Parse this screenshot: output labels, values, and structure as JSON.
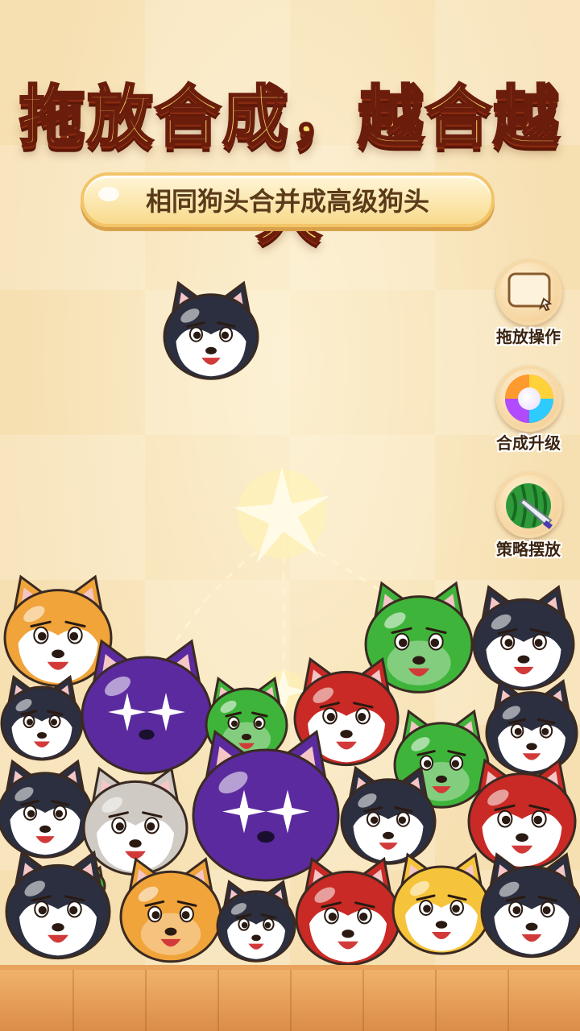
{
  "headline": "拖放合成，越合越大",
  "subtitle": "相同狗头合并成高级狗头",
  "side_buttons": [
    {
      "label": "拖放操作",
      "icon": "drag-card-icon"
    },
    {
      "label": "合成升级",
      "icon": "rainbow-orb-icon"
    },
    {
      "label": "策略摆放",
      "icon": "watermelon-knife-icon"
    }
  ],
  "colors": {
    "headline_fill": "#ffe066",
    "headline_outline": "#6b1d0c",
    "background": "#f6dfb0",
    "floor": "#e09a52",
    "dog_black": "#2b2f3f",
    "dog_orange": "#f0a43a",
    "dog_green": "#3fb43a",
    "dog_red": "#c92a25",
    "dog_purple": "#5b2a9e",
    "dog_gray": "#cfcac4",
    "dog_yellow": "#f6c43a"
  },
  "dogs": [
    {
      "id": "falling",
      "type": "husky-black",
      "color": "#2b2f3f",
      "face": "white"
    },
    {
      "id": "d1",
      "type": "shiba-orange",
      "color": "#f0a43a",
      "face": "white"
    },
    {
      "id": "d2",
      "type": "husky-black",
      "color": "#2b2f3f",
      "face": "white"
    },
    {
      "id": "d3",
      "type": "purple-giant",
      "color": "#5b2a9e",
      "face": "dark"
    },
    {
      "id": "d4",
      "type": "green-dog",
      "color": "#3fb43a",
      "face": "light"
    },
    {
      "id": "d5",
      "type": "red-dog",
      "color": "#c92a25",
      "face": "white"
    },
    {
      "id": "d6",
      "type": "green-dog",
      "color": "#3fb43a",
      "face": "light"
    },
    {
      "id": "d7",
      "type": "husky-black",
      "color": "#2b2f3f",
      "face": "white"
    },
    {
      "id": "d8",
      "type": "husky-black",
      "color": "#2b2f3f",
      "face": "white"
    },
    {
      "id": "d9",
      "type": "green-dog",
      "color": "#3fb43a",
      "face": "light"
    },
    {
      "id": "d10",
      "type": "husky-black",
      "color": "#2b2f3f",
      "face": "white"
    },
    {
      "id": "d11",
      "type": "gray-dog",
      "color": "#cfcac4",
      "face": "white"
    },
    {
      "id": "d12",
      "type": "purple-giant",
      "color": "#5b2a9e",
      "face": "dark"
    },
    {
      "id": "d13",
      "type": "husky-black",
      "color": "#2b2f3f",
      "face": "white"
    },
    {
      "id": "d14",
      "type": "red-dog",
      "color": "#c92a25",
      "face": "white"
    },
    {
      "id": "d15",
      "type": "husky-black",
      "color": "#2b2f3f",
      "face": "white"
    },
    {
      "id": "d16",
      "type": "orange-dog",
      "color": "#f0a43a",
      "face": "light"
    },
    {
      "id": "d17",
      "type": "husky-black",
      "color": "#2b2f3f",
      "face": "white"
    },
    {
      "id": "d18",
      "type": "red-dog",
      "color": "#c92a25",
      "face": "white"
    },
    {
      "id": "d19",
      "type": "yellow-dog",
      "color": "#f6c43a",
      "face": "white"
    },
    {
      "id": "d20",
      "type": "husky-black",
      "color": "#2b2f3f",
      "face": "white"
    },
    {
      "id": "d21",
      "type": "green-dog",
      "color": "#3fb43a",
      "face": "light"
    },
    {
      "id": "d22",
      "type": "red-dog",
      "color": "#c92a25",
      "face": "white"
    }
  ]
}
